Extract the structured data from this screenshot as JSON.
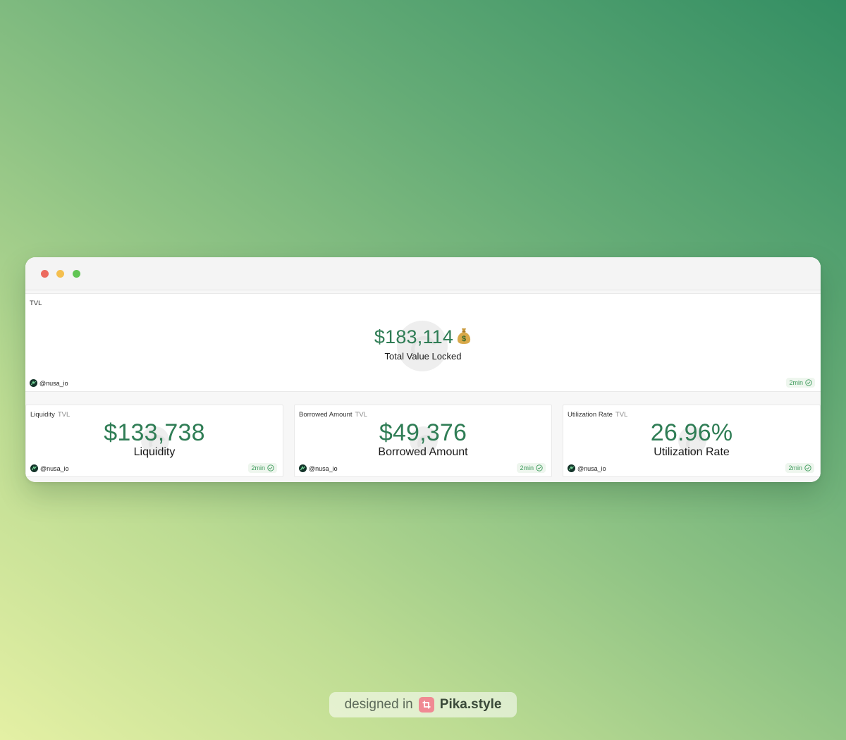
{
  "window": {
    "controls": [
      "close",
      "minimize",
      "zoom"
    ]
  },
  "tvl_card": {
    "title": "TVL",
    "value": "$183,114",
    "emoji_icon": "money-bag-icon",
    "label": "Total Value Locked",
    "author": "@nusa_io",
    "refresh": "2min"
  },
  "cards": [
    {
      "title": "Liquidity",
      "tag": "TVL",
      "value": "$133,738",
      "label": "Liquidity",
      "author": "@nusa_io",
      "refresh": "2min"
    },
    {
      "title": "Borrowed Amount",
      "tag": "TVL",
      "value": "$49,376",
      "label": "Borrowed Amount",
      "author": "@nusa_io",
      "refresh": "2min"
    },
    {
      "title": "Utilization Rate",
      "tag": "TVL",
      "value": "26.96%",
      "label": "Utilization Rate",
      "author": "@nusa_io",
      "refresh": "2min"
    }
  ],
  "footer": {
    "prefix": "designed in",
    "brand": "Pika.style"
  },
  "colors": {
    "value_green": "#2f7d55",
    "badge_green": "#3c9a5a",
    "close": "#ec6a5e",
    "minimize": "#f4bf4f",
    "zoom": "#61c554"
  }
}
